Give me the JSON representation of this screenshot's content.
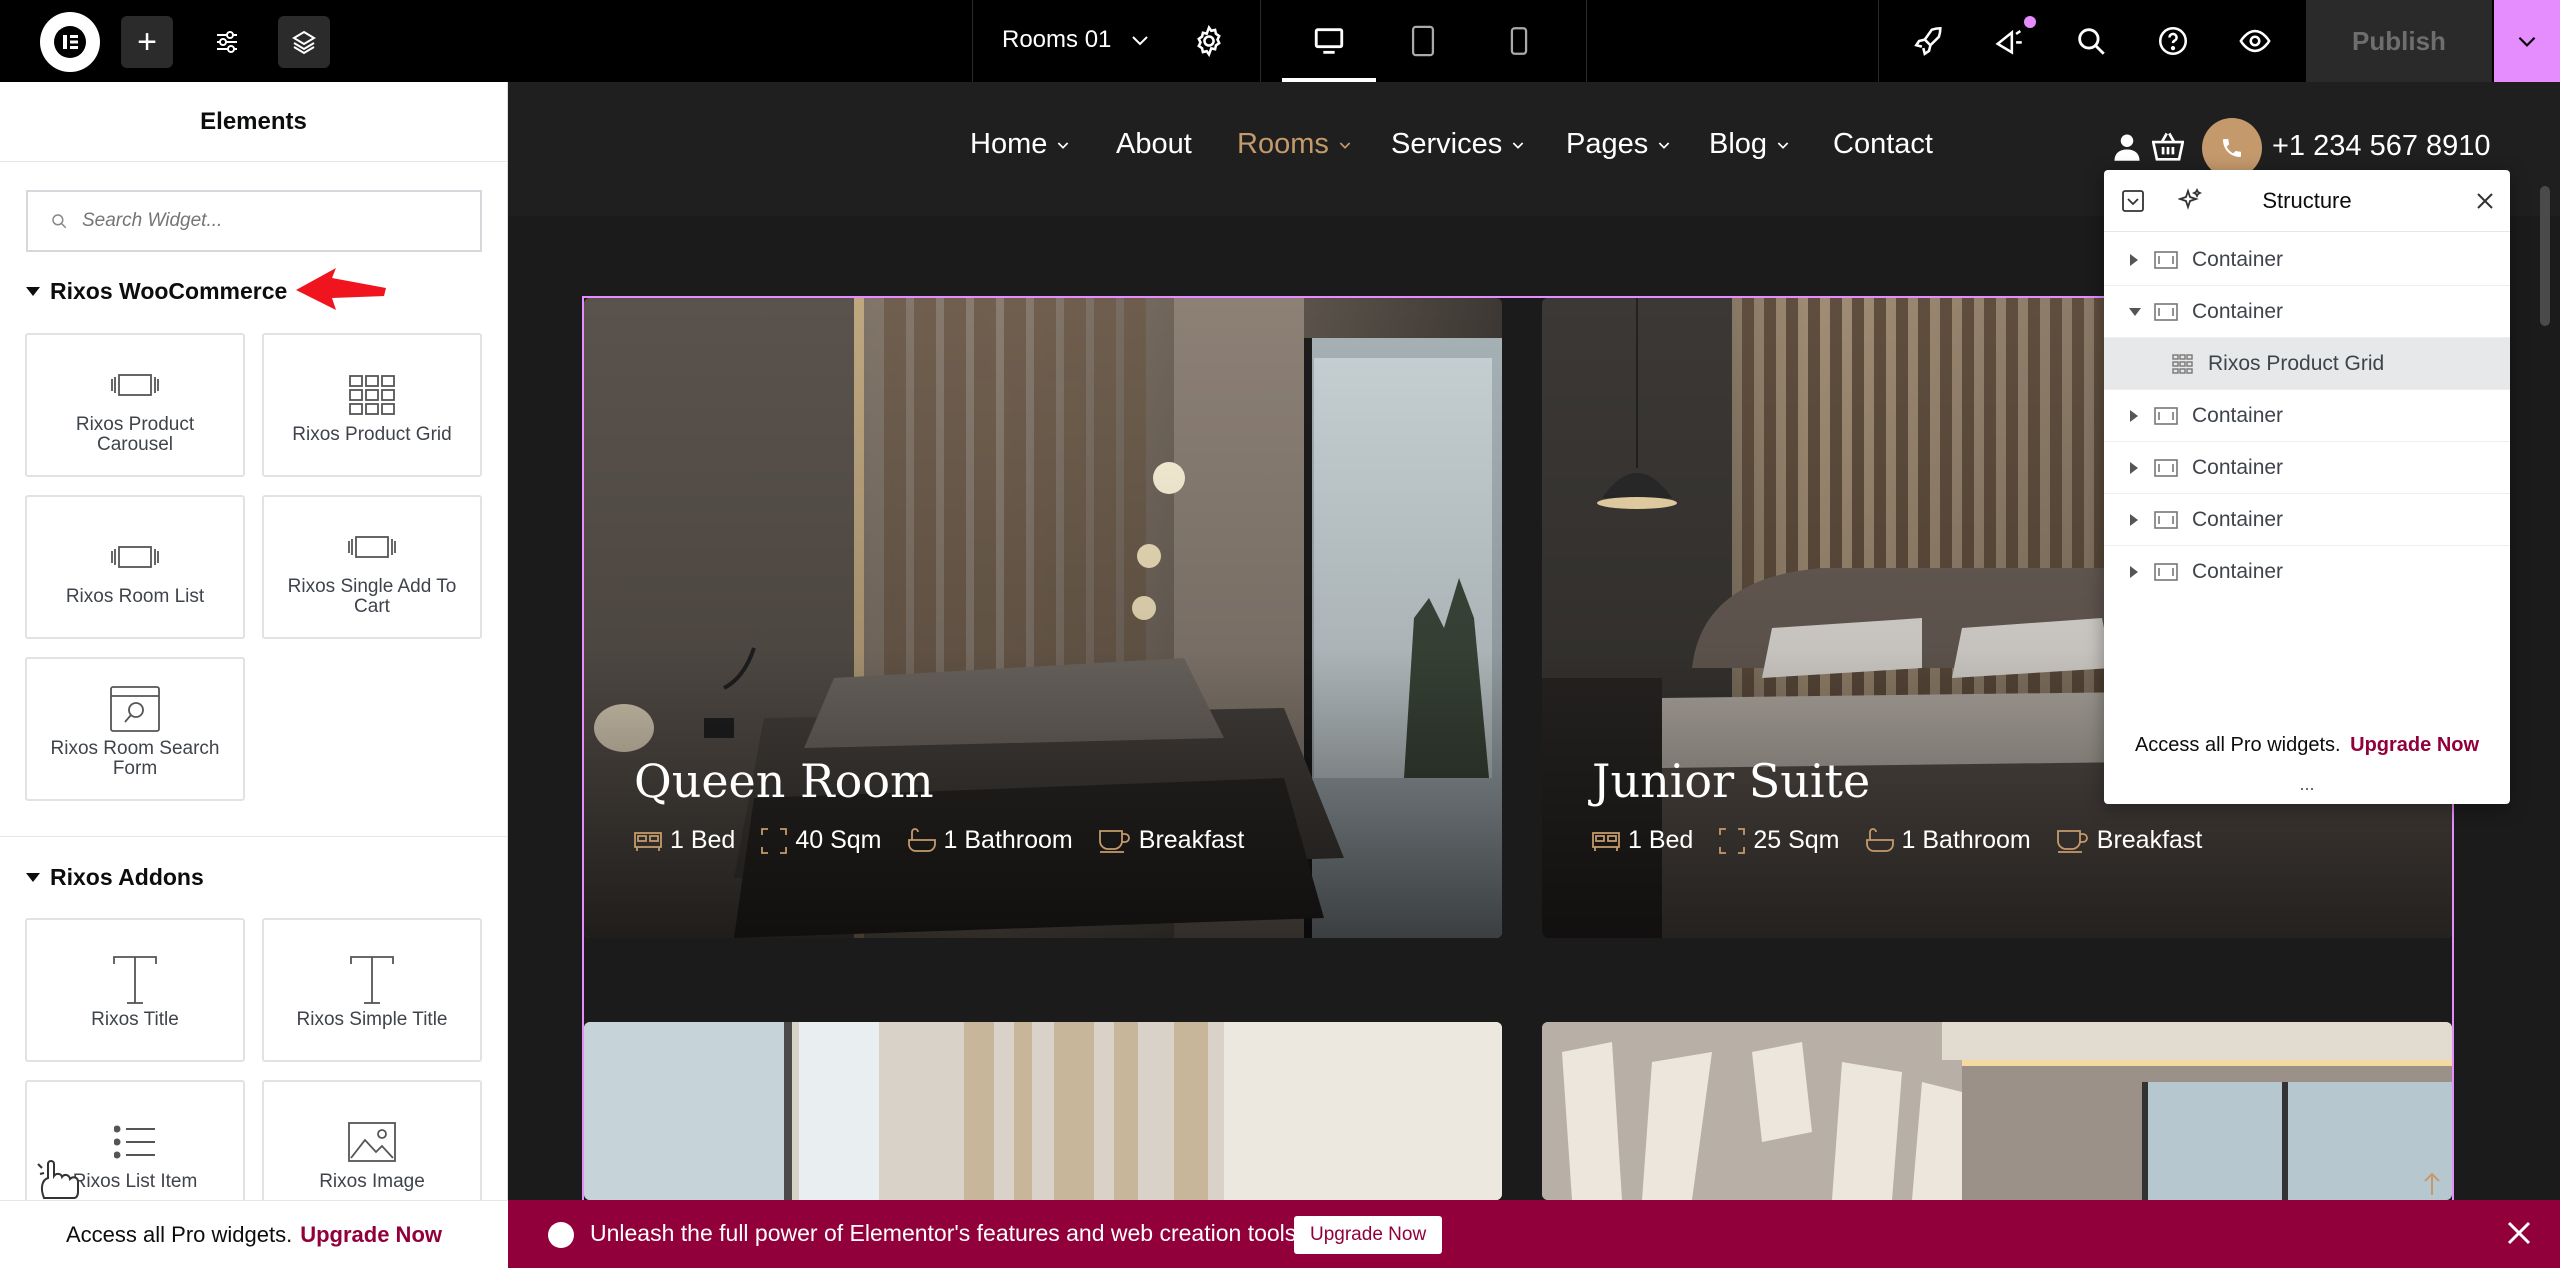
{
  "topbar": {
    "document_title": "Rooms 01",
    "publish_label": "Publish"
  },
  "panel": {
    "title": "Elements",
    "search_placeholder": "Search Widget...",
    "categories": [
      {
        "label": "Rixos WooCommerce"
      },
      {
        "label": "Rixos Addons"
      }
    ],
    "woo_widgets": [
      {
        "label": "Rixos Product Carousel",
        "icon": "carousel-icon"
      },
      {
        "label": "Rixos Product Grid",
        "icon": "grid-icon"
      },
      {
        "label": "Rixos Room List",
        "icon": "carousel-icon"
      },
      {
        "label": "Rixos Single Add To Cart",
        "icon": "carousel-icon"
      },
      {
        "label": "Rixos Room Search Form",
        "icon": "search-form-icon"
      }
    ],
    "addon_widgets": [
      {
        "label": "Rixos Title",
        "icon": "title-icon"
      },
      {
        "label": "Rixos Simple Title",
        "icon": "title-icon"
      },
      {
        "label": "Rixos List Item",
        "icon": "list-icon"
      },
      {
        "label": "Rixos Image",
        "icon": "image-icon"
      }
    ],
    "footer_text": "Access all Pro widgets.",
    "footer_link": "Upgrade Now"
  },
  "site": {
    "nav": [
      {
        "label": "Home",
        "has_dropdown": true
      },
      {
        "label": "About",
        "has_dropdown": false
      },
      {
        "label": "Rooms",
        "has_dropdown": true,
        "active": true
      },
      {
        "label": "Services",
        "has_dropdown": true
      },
      {
        "label": "Pages",
        "has_dropdown": true
      },
      {
        "label": "Blog",
        "has_dropdown": true
      },
      {
        "label": "Contact",
        "has_dropdown": false
      }
    ],
    "phone": "+1 234 567 8910",
    "accent_color": "#c49a6c",
    "rooms": [
      {
        "title": "Queen Room",
        "bed": "1 Bed",
        "size": "40 Sqm",
        "bath": "1 Bathroom",
        "breakfast": "Breakfast"
      },
      {
        "title": "Junior Suite",
        "bed": "1 Bed",
        "size": "25 Sqm",
        "bath": "1 Bathroom",
        "breakfast": "Breakfast"
      }
    ]
  },
  "structure": {
    "title": "Structure",
    "rows": [
      {
        "label": "Container",
        "caret": "right"
      },
      {
        "label": "Container",
        "caret": "down"
      },
      {
        "label": "Rixos Product Grid",
        "caret": "none",
        "selected": true
      },
      {
        "label": "Container",
        "caret": "right"
      },
      {
        "label": "Container",
        "caret": "right"
      },
      {
        "label": "Container",
        "caret": "right"
      },
      {
        "label": "Container",
        "caret": "right"
      }
    ],
    "footer_text": "Access all Pro widgets.",
    "footer_link": "Upgrade Now",
    "more": "..."
  },
  "promo": {
    "text": "Unleash the full power of Elementor's features and web creation tools.",
    "button": "Upgrade Now",
    "color": "#92003b"
  }
}
